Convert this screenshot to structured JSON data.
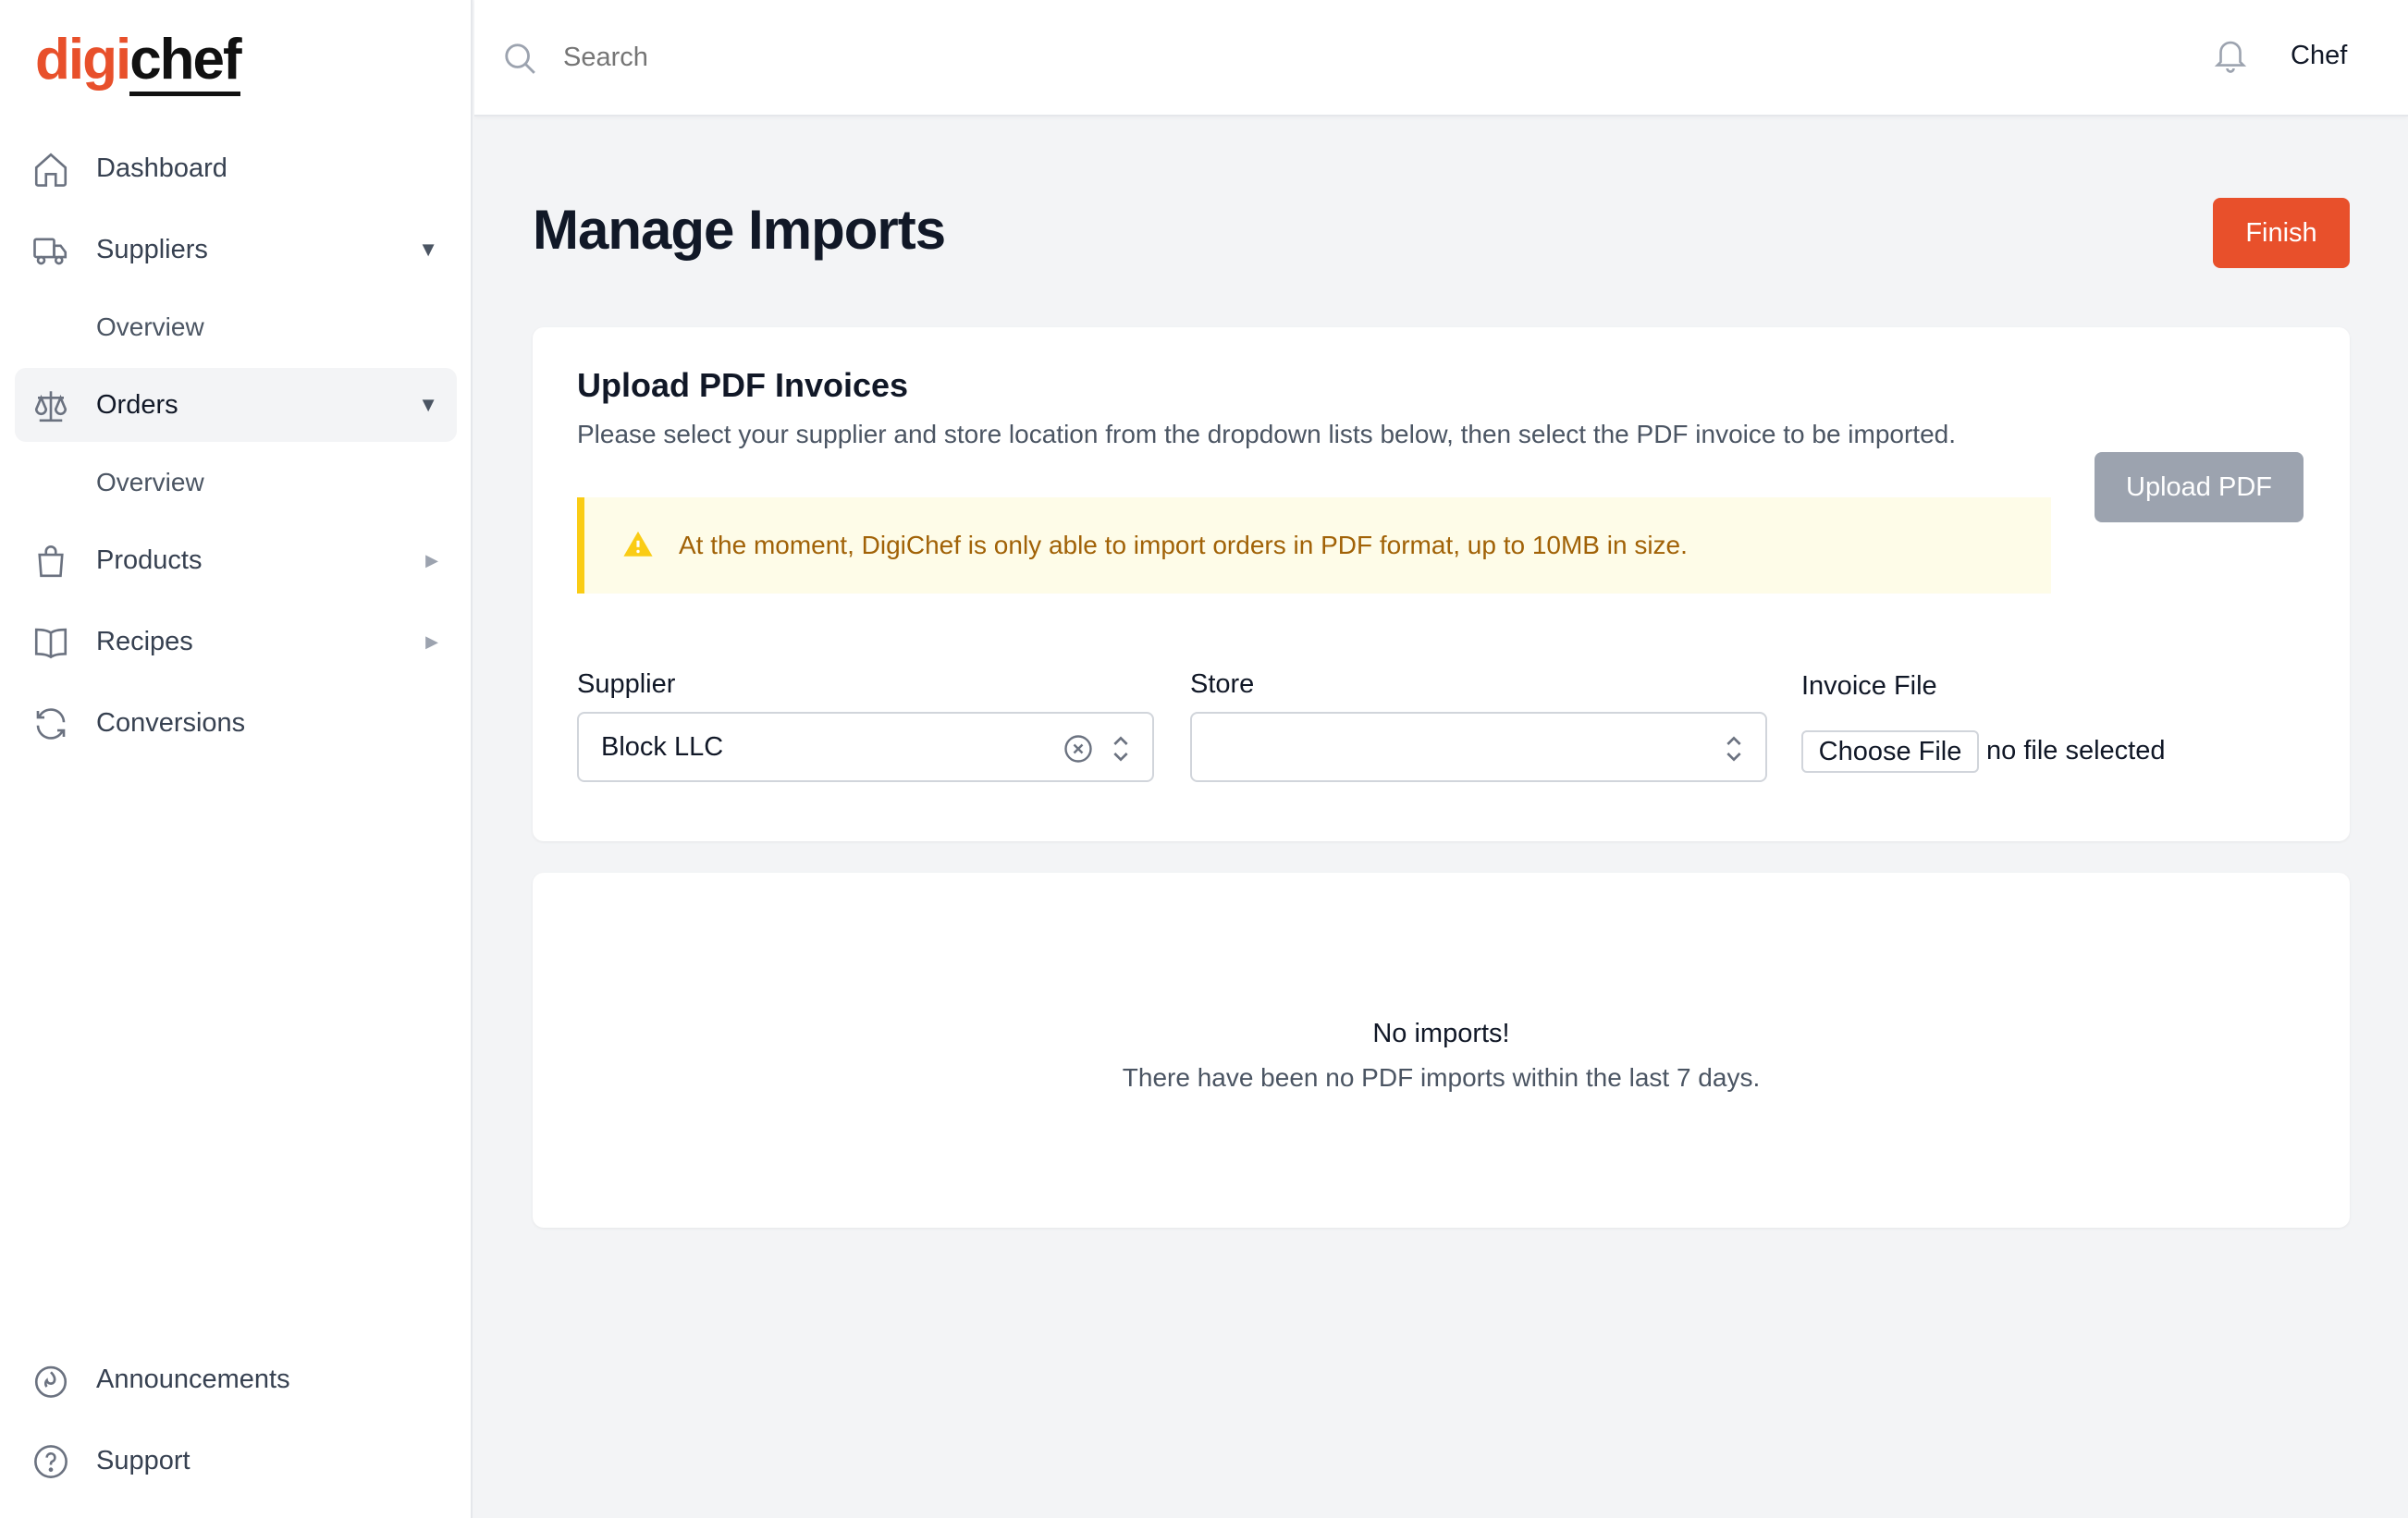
{
  "brand": {
    "logo_part1": "digi",
    "logo_part2": "chef",
    "accent": "#e8502b"
  },
  "sidebar": {
    "items": [
      {
        "label": "Dashboard",
        "icon": "home-icon"
      },
      {
        "label": "Suppliers",
        "icon": "truck-icon",
        "expanded": true
      },
      {
        "label": "Overview"
      },
      {
        "label": "Orders",
        "icon": "scale-icon",
        "expanded": true,
        "active": true
      },
      {
        "label": "Overview"
      },
      {
        "label": "Products",
        "icon": "shopping-bag-icon"
      },
      {
        "label": "Recipes",
        "icon": "book-icon"
      },
      {
        "label": "Conversions",
        "icon": "refresh-icon"
      }
    ],
    "footer": [
      {
        "label": "Announcements",
        "icon": "flame-icon"
      },
      {
        "label": "Support",
        "icon": "question-icon"
      }
    ]
  },
  "header": {
    "search_placeholder": "Search",
    "user": "Chef"
  },
  "main": {
    "title": "Manage Imports",
    "finish_label": "Finish",
    "upload_card": {
      "title": "Upload PDF Invoices",
      "description": "Please select your supplier and store location from the dropdown lists below, then select the PDF invoice to be imported.",
      "upload_label": "Upload PDF",
      "alert": "At the moment, DigiChef is only able to import orders in PDF format, up to 10MB in size.",
      "supplier_label": "Supplier",
      "supplier_value": "Block LLC",
      "store_label": "Store",
      "store_value": "",
      "invoice_label": "Invoice File",
      "choose_file_label": "Choose File",
      "no_file_text": "no file selected"
    },
    "empty_state": {
      "title": "No imports!",
      "description": "There have been no PDF imports within the last 7 days."
    }
  }
}
